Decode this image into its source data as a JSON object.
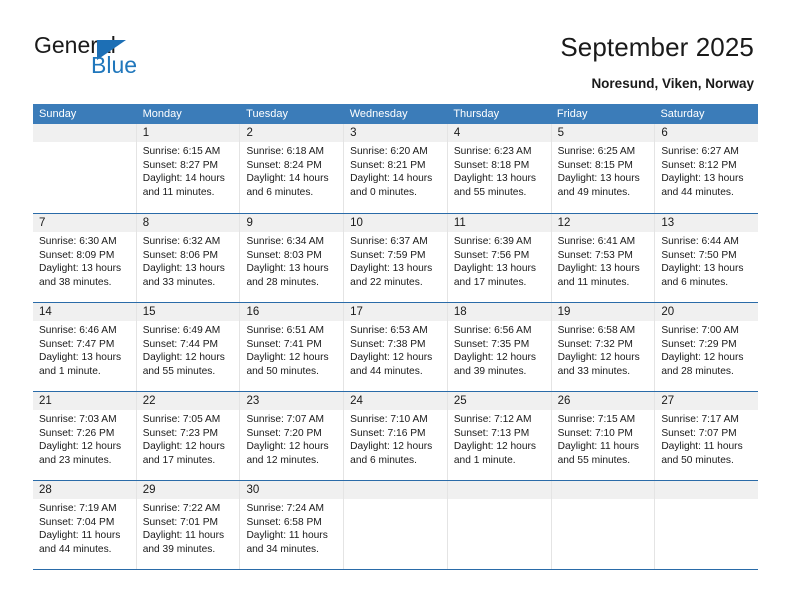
{
  "brand": {
    "name_top": "General",
    "name_bottom": "Blue",
    "flag_icon": "triangle-flag-icon",
    "accent_color": "#2077bc"
  },
  "header": {
    "title": "September 2025",
    "location": "Noresund, Viken, Norway"
  },
  "theme": {
    "header_blue": "#3b7cb9",
    "row_divider": "#2a6ba8",
    "daynum_band": "#f0f0f0"
  },
  "weekdays": [
    "Sunday",
    "Monday",
    "Tuesday",
    "Wednesday",
    "Thursday",
    "Friday",
    "Saturday"
  ],
  "weeks": [
    [
      {
        "day": "",
        "lines": []
      },
      {
        "day": "1",
        "lines": [
          "Sunrise: 6:15 AM",
          "Sunset: 8:27 PM",
          "Daylight: 14 hours",
          "and 11 minutes."
        ]
      },
      {
        "day": "2",
        "lines": [
          "Sunrise: 6:18 AM",
          "Sunset: 8:24 PM",
          "Daylight: 14 hours",
          "and 6 minutes."
        ]
      },
      {
        "day": "3",
        "lines": [
          "Sunrise: 6:20 AM",
          "Sunset: 8:21 PM",
          "Daylight: 14 hours",
          "and 0 minutes."
        ]
      },
      {
        "day": "4",
        "lines": [
          "Sunrise: 6:23 AM",
          "Sunset: 8:18 PM",
          "Daylight: 13 hours",
          "and 55 minutes."
        ]
      },
      {
        "day": "5",
        "lines": [
          "Sunrise: 6:25 AM",
          "Sunset: 8:15 PM",
          "Daylight: 13 hours",
          "and 49 minutes."
        ]
      },
      {
        "day": "6",
        "lines": [
          "Sunrise: 6:27 AM",
          "Sunset: 8:12 PM",
          "Daylight: 13 hours",
          "and 44 minutes."
        ]
      }
    ],
    [
      {
        "day": "7",
        "lines": [
          "Sunrise: 6:30 AM",
          "Sunset: 8:09 PM",
          "Daylight: 13 hours",
          "and 38 minutes."
        ]
      },
      {
        "day": "8",
        "lines": [
          "Sunrise: 6:32 AM",
          "Sunset: 8:06 PM",
          "Daylight: 13 hours",
          "and 33 minutes."
        ]
      },
      {
        "day": "9",
        "lines": [
          "Sunrise: 6:34 AM",
          "Sunset: 8:03 PM",
          "Daylight: 13 hours",
          "and 28 minutes."
        ]
      },
      {
        "day": "10",
        "lines": [
          "Sunrise: 6:37 AM",
          "Sunset: 7:59 PM",
          "Daylight: 13 hours",
          "and 22 minutes."
        ]
      },
      {
        "day": "11",
        "lines": [
          "Sunrise: 6:39 AM",
          "Sunset: 7:56 PM",
          "Daylight: 13 hours",
          "and 17 minutes."
        ]
      },
      {
        "day": "12",
        "lines": [
          "Sunrise: 6:41 AM",
          "Sunset: 7:53 PM",
          "Daylight: 13 hours",
          "and 11 minutes."
        ]
      },
      {
        "day": "13",
        "lines": [
          "Sunrise: 6:44 AM",
          "Sunset: 7:50 PM",
          "Daylight: 13 hours",
          "and 6 minutes."
        ]
      }
    ],
    [
      {
        "day": "14",
        "lines": [
          "Sunrise: 6:46 AM",
          "Sunset: 7:47 PM",
          "Daylight: 13 hours",
          "and 1 minute."
        ]
      },
      {
        "day": "15",
        "lines": [
          "Sunrise: 6:49 AM",
          "Sunset: 7:44 PM",
          "Daylight: 12 hours",
          "and 55 minutes."
        ]
      },
      {
        "day": "16",
        "lines": [
          "Sunrise: 6:51 AM",
          "Sunset: 7:41 PM",
          "Daylight: 12 hours",
          "and 50 minutes."
        ]
      },
      {
        "day": "17",
        "lines": [
          "Sunrise: 6:53 AM",
          "Sunset: 7:38 PM",
          "Daylight: 12 hours",
          "and 44 minutes."
        ]
      },
      {
        "day": "18",
        "lines": [
          "Sunrise: 6:56 AM",
          "Sunset: 7:35 PM",
          "Daylight: 12 hours",
          "and 39 minutes."
        ]
      },
      {
        "day": "19",
        "lines": [
          "Sunrise: 6:58 AM",
          "Sunset: 7:32 PM",
          "Daylight: 12 hours",
          "and 33 minutes."
        ]
      },
      {
        "day": "20",
        "lines": [
          "Sunrise: 7:00 AM",
          "Sunset: 7:29 PM",
          "Daylight: 12 hours",
          "and 28 minutes."
        ]
      }
    ],
    [
      {
        "day": "21",
        "lines": [
          "Sunrise: 7:03 AM",
          "Sunset: 7:26 PM",
          "Daylight: 12 hours",
          "and 23 minutes."
        ]
      },
      {
        "day": "22",
        "lines": [
          "Sunrise: 7:05 AM",
          "Sunset: 7:23 PM",
          "Daylight: 12 hours",
          "and 17 minutes."
        ]
      },
      {
        "day": "23",
        "lines": [
          "Sunrise: 7:07 AM",
          "Sunset: 7:20 PM",
          "Daylight: 12 hours",
          "and 12 minutes."
        ]
      },
      {
        "day": "24",
        "lines": [
          "Sunrise: 7:10 AM",
          "Sunset: 7:16 PM",
          "Daylight: 12 hours",
          "and 6 minutes."
        ]
      },
      {
        "day": "25",
        "lines": [
          "Sunrise: 7:12 AM",
          "Sunset: 7:13 PM",
          "Daylight: 12 hours",
          "and 1 minute."
        ]
      },
      {
        "day": "26",
        "lines": [
          "Sunrise: 7:15 AM",
          "Sunset: 7:10 PM",
          "Daylight: 11 hours",
          "and 55 minutes."
        ]
      },
      {
        "day": "27",
        "lines": [
          "Sunrise: 7:17 AM",
          "Sunset: 7:07 PM",
          "Daylight: 11 hours",
          "and 50 minutes."
        ]
      }
    ],
    [
      {
        "day": "28",
        "lines": [
          "Sunrise: 7:19 AM",
          "Sunset: 7:04 PM",
          "Daylight: 11 hours",
          "and 44 minutes."
        ]
      },
      {
        "day": "29",
        "lines": [
          "Sunrise: 7:22 AM",
          "Sunset: 7:01 PM",
          "Daylight: 11 hours",
          "and 39 minutes."
        ]
      },
      {
        "day": "30",
        "lines": [
          "Sunrise: 7:24 AM",
          "Sunset: 6:58 PM",
          "Daylight: 11 hours",
          "and 34 minutes."
        ]
      },
      {
        "day": "",
        "lines": []
      },
      {
        "day": "",
        "lines": []
      },
      {
        "day": "",
        "lines": []
      },
      {
        "day": "",
        "lines": []
      }
    ]
  ]
}
